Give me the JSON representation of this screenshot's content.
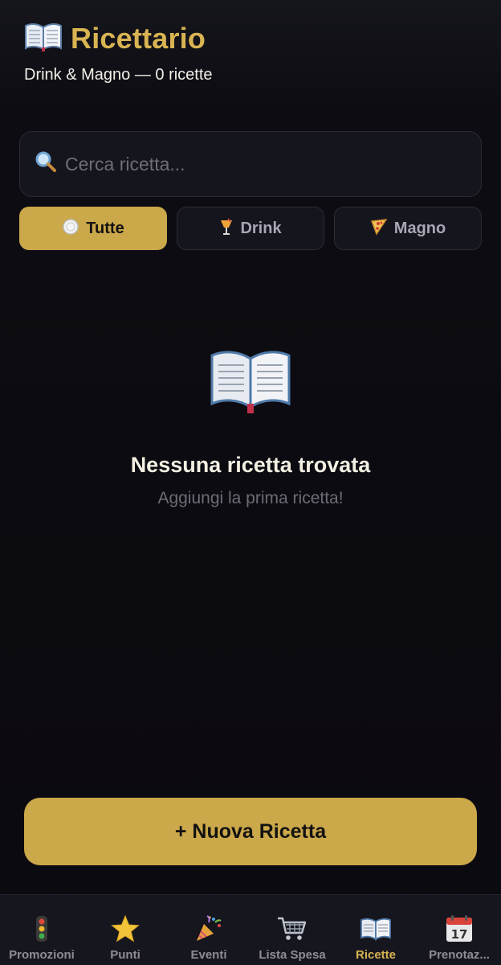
{
  "header": {
    "title": "Ricettario",
    "title_icon": "open-book-icon",
    "subtitle": "Drink & Magno — 0 ricette"
  },
  "search": {
    "placeholder": "Cerca ricetta...",
    "value": "",
    "icon": "magnifier-icon"
  },
  "filters": [
    {
      "label": "Tutte",
      "icon": "plate-icon",
      "active": true
    },
    {
      "label": "Drink",
      "icon": "cocktail-icon",
      "active": false
    },
    {
      "label": "Magno",
      "icon": "pizza-icon",
      "active": false
    }
  ],
  "empty_state": {
    "icon": "open-book-icon",
    "title": "Nessuna ricetta trovata",
    "subtitle": "Aggiungi la prima ricetta!"
  },
  "new_button": {
    "label": "+ Nuova Ricetta"
  },
  "tabbar": [
    {
      "label": "Promozioni",
      "icon": "traffic-light-icon",
      "active": false
    },
    {
      "label": "Punti",
      "icon": "star-icon",
      "active": false
    },
    {
      "label": "Eventi",
      "icon": "party-popper-icon",
      "active": false
    },
    {
      "label": "Lista Spesa",
      "icon": "shopping-cart-icon",
      "active": false
    },
    {
      "label": "Ricette",
      "icon": "open-book-icon",
      "active": true
    },
    {
      "label": "Prenotaz...",
      "icon": "calendar-icon",
      "active": false
    }
  ],
  "colors": {
    "accent": "#cba84a",
    "title": "#d8b452",
    "background": "#0c0b10",
    "card": "#15151e"
  }
}
